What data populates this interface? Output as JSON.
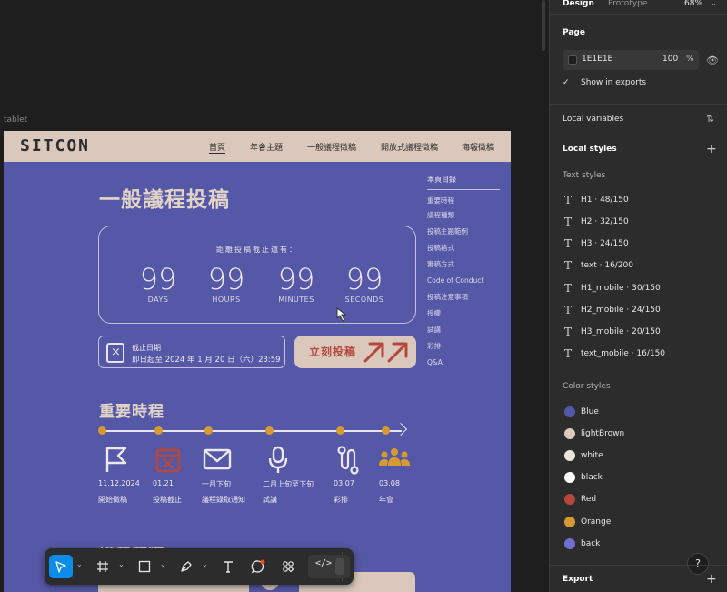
{
  "canvas": {
    "frame_label": "tablet",
    "site": {
      "logo": "SITCON",
      "nav": [
        "首頁",
        "年會主題",
        "一般議程徵稿",
        "開放式議程徵稿",
        "海報徵稿"
      ],
      "title": "一般議程投稿",
      "countdown": {
        "caption": "距離投稿截止還有：",
        "units": [
          {
            "value": "99",
            "label": "DAYS"
          },
          {
            "value": "99",
            "label": "HOURS"
          },
          {
            "value": "99",
            "label": "MINUTES"
          },
          {
            "value": "99",
            "label": "SECONDS"
          }
        ]
      },
      "deadline": {
        "title": "截止日期",
        "text": "即日起至 2024 年 1 月 20 日（六）23:59"
      },
      "submit_label": "立刻投稿",
      "toc": {
        "title": "本頁目錄",
        "items": [
          "重要時程",
          "議程種類",
          "投稿主題範例",
          "投稿格式",
          "審稿方式",
          "Code of Conduct",
          "投稿注意事項",
          "授權",
          "試講",
          "彩排",
          "Q&A"
        ]
      },
      "schedule_title": "重要時程",
      "milestones": [
        {
          "icon": "flag-icon",
          "date": "11.12.2024",
          "label": "開始徵稿"
        },
        {
          "icon": "calendar-x-icon",
          "date": "01.21",
          "label": "投稿截止"
        },
        {
          "icon": "mail-icon",
          "date": "一月下旬",
          "label": "議程錄取通知"
        },
        {
          "icon": "microphone-icon",
          "date": "二月上旬至下旬",
          "label": "試講"
        },
        {
          "icon": "route-icon",
          "date": "03.07",
          "label": "彩排"
        },
        {
          "icon": "people-icon",
          "date": "03.08",
          "label": "年會"
        }
      ],
      "session_types_title": "議程種類",
      "colors": {
        "purple": "#5558a6",
        "light_brown": "#d9c8bb",
        "red": "#b6473d",
        "orange": "#d69b30"
      }
    },
    "toolbar": {
      "tools": [
        "move-tool",
        "frame-tool",
        "shape-tool",
        "pen-tool",
        "text-tool",
        "comment-tool",
        "components-tool",
        "dev-mode-toggle"
      ],
      "dev_code_glyph": "</>"
    }
  },
  "panel": {
    "tabs": [
      "Design",
      "Prototype"
    ],
    "zoom": "68%",
    "page": {
      "title": "Page",
      "color_hex": "1E1E1E",
      "opacity": "100",
      "percent": "%",
      "show_in_exports": "Show in exports"
    },
    "local_variables": "Local variables",
    "local_styles": "Local styles",
    "text_styles_title": "Text styles",
    "text_styles": [
      "H1 · 48/150",
      "H2 · 32/150",
      "H3 · 24/150",
      "text · 16/200",
      "H1_mobile · 30/150",
      "H2_mobile · 24/150",
      "H3_mobile · 20/150",
      "text_mobile · 16/150"
    ],
    "color_styles_title": "Color styles",
    "color_styles": [
      {
        "name": "Blue",
        "color": "#5558a6"
      },
      {
        "name": "lightBrown",
        "color": "#d9c8bb"
      },
      {
        "name": "white",
        "color": "#ebe6dc"
      },
      {
        "name": "black",
        "color": "#ffffff"
      },
      {
        "name": "Red",
        "color": "#b6473d"
      },
      {
        "name": "Orange",
        "color": "#d69b30"
      },
      {
        "name": "back",
        "color": "#6f6fd0"
      }
    ],
    "export": "Export",
    "help": "?"
  }
}
